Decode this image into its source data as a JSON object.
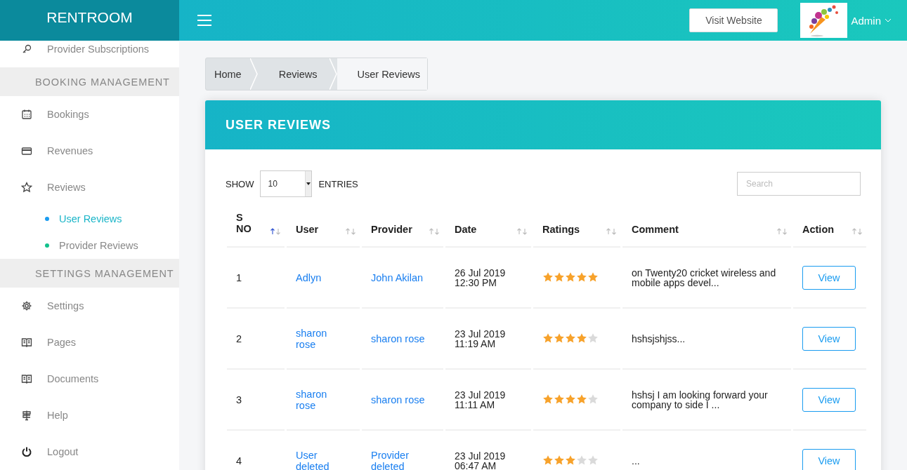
{
  "brand": "RENTROOM",
  "topbar": {
    "visit_button": "Visit Website",
    "user": "Admin"
  },
  "sidebar": {
    "items": [
      {
        "kind": "link",
        "label": "Provider Subscriptions"
      },
      {
        "kind": "section",
        "label": "BOOKING MANAGEMENT"
      },
      {
        "kind": "link",
        "label": "Bookings"
      },
      {
        "kind": "link",
        "label": "Revenues"
      },
      {
        "kind": "link",
        "label": "Reviews"
      },
      {
        "kind": "sub",
        "label": "User Reviews",
        "selected": true,
        "color": "#1a9cf0"
      },
      {
        "kind": "sub",
        "label": "Provider Reviews",
        "selected": false,
        "color": "#13c18c"
      },
      {
        "kind": "section",
        "label": "SETTINGS MANAGEMENT"
      },
      {
        "kind": "link",
        "label": "Settings"
      },
      {
        "kind": "link",
        "label": "Pages"
      },
      {
        "kind": "link",
        "label": "Documents"
      },
      {
        "kind": "link",
        "label": "Help"
      },
      {
        "kind": "link",
        "label": "Logout"
      }
    ]
  },
  "breadcrumb": [
    "Home",
    "Reviews",
    "User Reviews"
  ],
  "card": {
    "title": "USER REVIEWS",
    "length": {
      "before": "SHOW",
      "value": "10",
      "after": "ENTRIES"
    },
    "search": {
      "placeholder": "Search"
    },
    "table": {
      "columns": [
        {
          "label": "S NO",
          "sorted": true
        },
        {
          "label": "User",
          "sorted": false
        },
        {
          "label": "Provider",
          "sorted": false
        },
        {
          "label": "Date",
          "sorted": false
        },
        {
          "label": "Ratings",
          "sorted": false
        },
        {
          "label": "Comment",
          "sorted": false
        },
        {
          "label": "Action",
          "sorted": false
        }
      ],
      "rows": [
        {
          "sno": "1",
          "user": "Adlyn",
          "provider": "John Akilan",
          "date": "26 Jul 2019",
          "time": "12:30 PM",
          "stars": 5,
          "comment": "on Twenty20 cricket wireless and mobile apps devel...",
          "action": "View"
        },
        {
          "sno": "2",
          "user": "sharon rose",
          "provider": "sharon rose",
          "date": "23 Jul 2019",
          "time": "11:19 AM",
          "stars": 4,
          "comment": "hshsjshjss...",
          "action": "View"
        },
        {
          "sno": "3",
          "user": "sharon rose",
          "provider": "sharon rose",
          "date": "23 Jul 2019",
          "time": "11:11 AM",
          "stars": 4,
          "comment": "hshsj I am looking forward your company to side I ...",
          "action": "View"
        },
        {
          "sno": "4",
          "user": "User deleted",
          "provider": "Provider deleted",
          "date": "23 Jul 2019",
          "time": "06:47 AM",
          "stars": 3,
          "comment": "...",
          "action": "View"
        }
      ]
    }
  }
}
